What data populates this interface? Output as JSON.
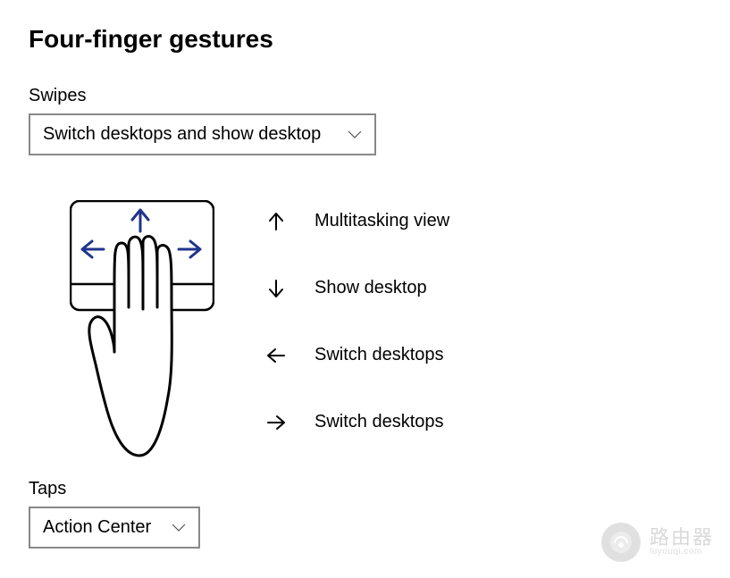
{
  "page": {
    "title": "Four-finger gestures"
  },
  "swipes": {
    "label": "Swipes",
    "selected": "Switch desktops and show desktop"
  },
  "gestures": [
    {
      "direction": "up",
      "label": "Multitasking view"
    },
    {
      "direction": "down",
      "label": "Show desktop"
    },
    {
      "direction": "left",
      "label": "Switch desktops"
    },
    {
      "direction": "right",
      "label": "Switch desktops"
    }
  ],
  "taps": {
    "label": "Taps",
    "selected": "Action Center"
  },
  "watermark": {
    "text": "路由器",
    "sub": "luyouqi.com"
  },
  "illustration": {
    "arrow_color": "#20348d"
  }
}
